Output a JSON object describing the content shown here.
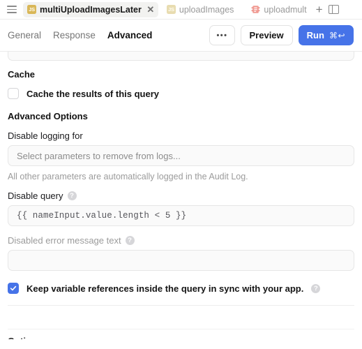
{
  "tabbar": {
    "menu_icon": "hamburger-icon",
    "tabs": [
      {
        "label": "multiUploadImagesLater",
        "icon": "js-icon",
        "active": true,
        "close": "✕"
      },
      {
        "label": "uploadImages",
        "icon": "js-icon",
        "active": false
      },
      {
        "label": "uploadmult",
        "icon": "api-icon",
        "active": false
      }
    ],
    "add_tab": "+",
    "panel_toggle_icon": "panel-layout-icon"
  },
  "toolbar": {
    "tabs": [
      {
        "label": "General",
        "selected": false
      },
      {
        "label": "Response",
        "selected": false
      },
      {
        "label": "Advanced",
        "selected": true
      }
    ],
    "more_label": "•••",
    "preview_label": "Preview",
    "run_label": "Run",
    "run_shortcut": "⌘↩",
    "accent_color": "#4673e8"
  },
  "main": {
    "cache": {
      "section_title": "Cache",
      "checkbox_label": "Cache the results of this query",
      "checked": false
    },
    "advanced_options": {
      "section_title": "Advanced Options",
      "disable_logging_label": "Disable logging for",
      "disable_logging_placeholder": "Select parameters to remove from logs...",
      "disable_logging_helper": "All other parameters are automatically logged in the Audit Log.",
      "disable_query_label": "Disable query",
      "disable_query_value": "{{ nameInput.value.length < 5 }}",
      "disable_query_help_icon": "help-circle-icon",
      "disabled_error_label": "Disabled error message text",
      "disabled_error_value": "",
      "disabled_error_help_icon": "help-circle-icon",
      "keep_sync_label": "Keep variable references inside the query in sync with your app.",
      "keep_sync_checked": true,
      "keep_sync_help_icon": "help-circle-icon"
    },
    "cut_off_section_title": "Options"
  }
}
